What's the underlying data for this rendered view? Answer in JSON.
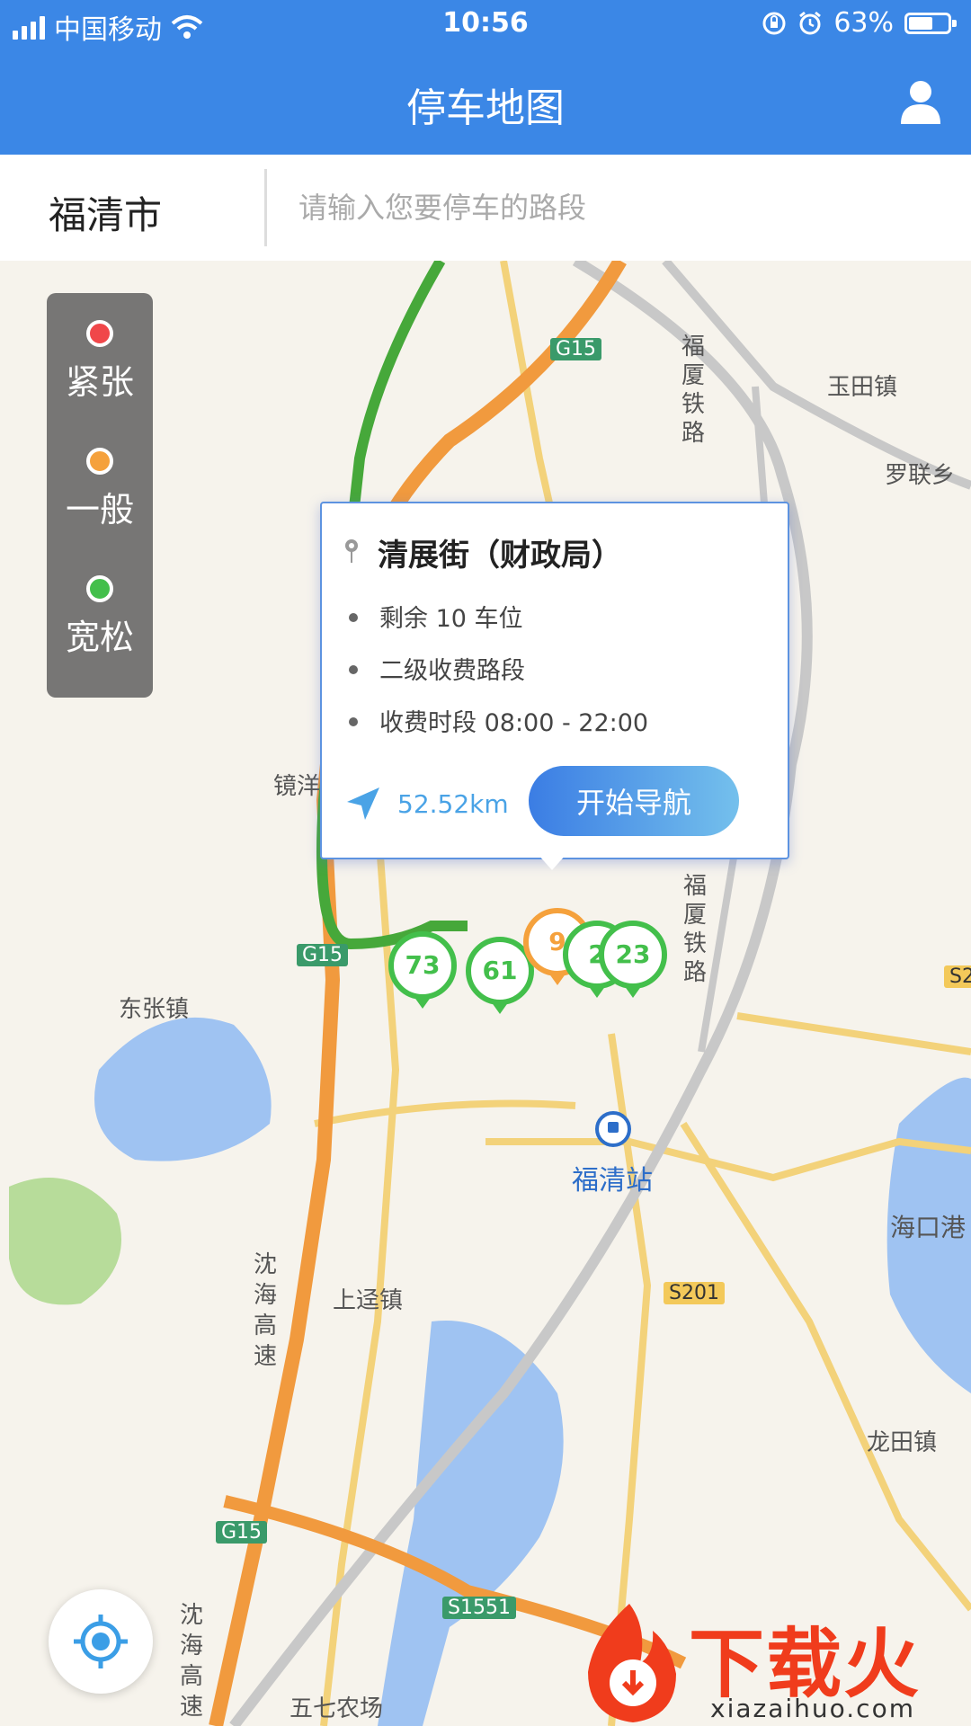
{
  "status_bar": {
    "carrier": "中国移动",
    "time": "10:56",
    "battery": "63%",
    "battery_level": 0.63
  },
  "header": {
    "title": "停车地图",
    "user_icon": "user-icon"
  },
  "search": {
    "city": "福清市",
    "placeholder": "请输入您要停车的路段"
  },
  "legend": [
    {
      "label": "紧张",
      "color": "#f0474a"
    },
    {
      "label": "一般",
      "color": "#f5a13c"
    },
    {
      "label": "宽松",
      "color": "#43bf4b"
    }
  ],
  "map": {
    "labels": [
      "玉田镇",
      "罗联乡",
      "镜洋镇",
      "东张镇",
      "福清站",
      "海口港",
      "上迳镇",
      "龙田镇",
      "五七农场",
      "沈海高速",
      "沈海高速",
      "福厦铁路",
      "福厦铁路"
    ],
    "road_tags": [
      "G15",
      "G15",
      "G15",
      "S201",
      "S1551",
      "S2"
    ],
    "clusters": [
      {
        "count": "73",
        "color": "#43bf4b"
      },
      {
        "count": "61",
        "color": "#43bf4b"
      },
      {
        "count": "9",
        "color": "#f5a13c"
      },
      {
        "count": "2",
        "color": "#43bf4b"
      },
      {
        "count": "23",
        "color": "#43bf4b"
      }
    ]
  },
  "popup": {
    "title": "清展街（财政局）",
    "remaining": "剩余 10 车位",
    "level": "二级收费路段",
    "hours": "收费时段 08:00 - 22:00",
    "distance": "52.52km",
    "nav_button": "开始导航"
  },
  "watermark": {
    "brand": "下载火",
    "site": "xiazaihuo.com"
  },
  "colors": {
    "primary": "#3b87e6",
    "tight": "#f0474a",
    "normal": "#f5a13c",
    "loose": "#43bf4b",
    "distance": "#4aa3e6"
  }
}
